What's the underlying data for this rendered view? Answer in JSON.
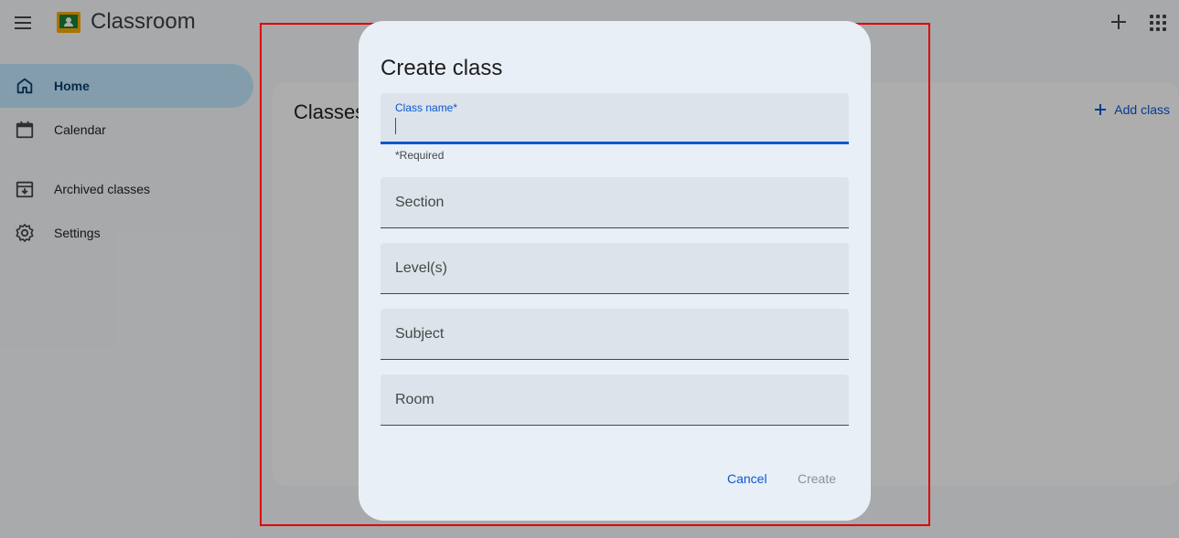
{
  "topbar": {
    "app_title": "Classroom"
  },
  "sidebar": {
    "items": [
      {
        "label": "Home",
        "icon": "home-icon",
        "active": true
      },
      {
        "label": "Calendar",
        "icon": "calendar-icon",
        "active": false
      },
      {
        "label": "Archived classes",
        "icon": "archive-icon",
        "active": false
      },
      {
        "label": "Settings",
        "icon": "gear-icon",
        "active": false
      }
    ]
  },
  "main": {
    "title": "Classes",
    "add_class_label": "Add class"
  },
  "dialog": {
    "title": "Create class",
    "class_name_label": "Class name*",
    "class_name_value": "",
    "required_note": "*Required",
    "section_placeholder": "Section",
    "levels_placeholder": "Level(s)",
    "subject_placeholder": "Subject",
    "room_placeholder": "Room",
    "cancel_label": "Cancel",
    "create_label": "Create"
  },
  "colors": {
    "accent": "#0b57d0",
    "active_nav": "#c2e7ff",
    "dialog_bg": "#e9eff7",
    "field_bg": "#dce3ea",
    "highlight": "#e00000"
  }
}
